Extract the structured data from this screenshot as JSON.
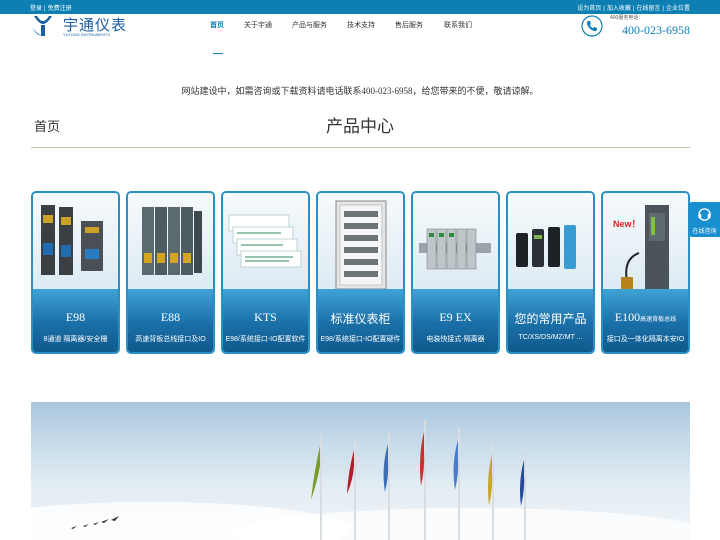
{
  "topbar": {
    "left_links": [
      "登录",
      "免费注册"
    ],
    "right_links": [
      "设为首页",
      "加入收藏",
      "在线留言",
      "企业位置"
    ]
  },
  "logo": {
    "name": "宇通仪表",
    "english": "YUTONG INSTRUMENTS"
  },
  "nav": {
    "items": [
      {
        "label": "首页",
        "active": true
      },
      {
        "label": "关于宇通",
        "active": false
      },
      {
        "label": "产品与服务",
        "active": false
      },
      {
        "label": "技术支持",
        "active": false
      },
      {
        "label": "售后服务",
        "active": false
      },
      {
        "label": "联系我们",
        "active": false
      }
    ]
  },
  "contact": {
    "label": "400服务电话：",
    "number": "400-023-6958",
    "icon": "phone-icon"
  },
  "notice": "网站建设中，如需咨询或下载资料请电话联系400-023-6958，给您带来的不便，敬请谅解。",
  "breadcrumb": {
    "home": "首页"
  },
  "section_title": "产品中心",
  "products": [
    {
      "title": "E98",
      "desc": "8通道 隔离器/安全栅"
    },
    {
      "title": "E88",
      "desc": "高速背板总线接口及IO"
    },
    {
      "title": "KTS",
      "desc": "E98/系统接口-IO配置软件"
    },
    {
      "title": "标准仪表柜",
      "desc": "E98/系统接口-IO配置硬件"
    },
    {
      "title": "E9 EX",
      "desc": "电装快接式-隔离器"
    },
    {
      "title": "您的常用产品",
      "desc": "TC/XS/DS/MZ/MT ..."
    },
    {
      "title": "E100",
      "subtitle": "高速背板总线",
      "desc": "接口及一体化隔离本安IO",
      "badge": "New！"
    }
  ],
  "online_chat": {
    "label": "在线咨询",
    "icon": "headset-icon"
  },
  "colors": {
    "brand": "#0d7fb3",
    "card_border": "#2a8fc2",
    "divider": "#b7c9a2"
  }
}
